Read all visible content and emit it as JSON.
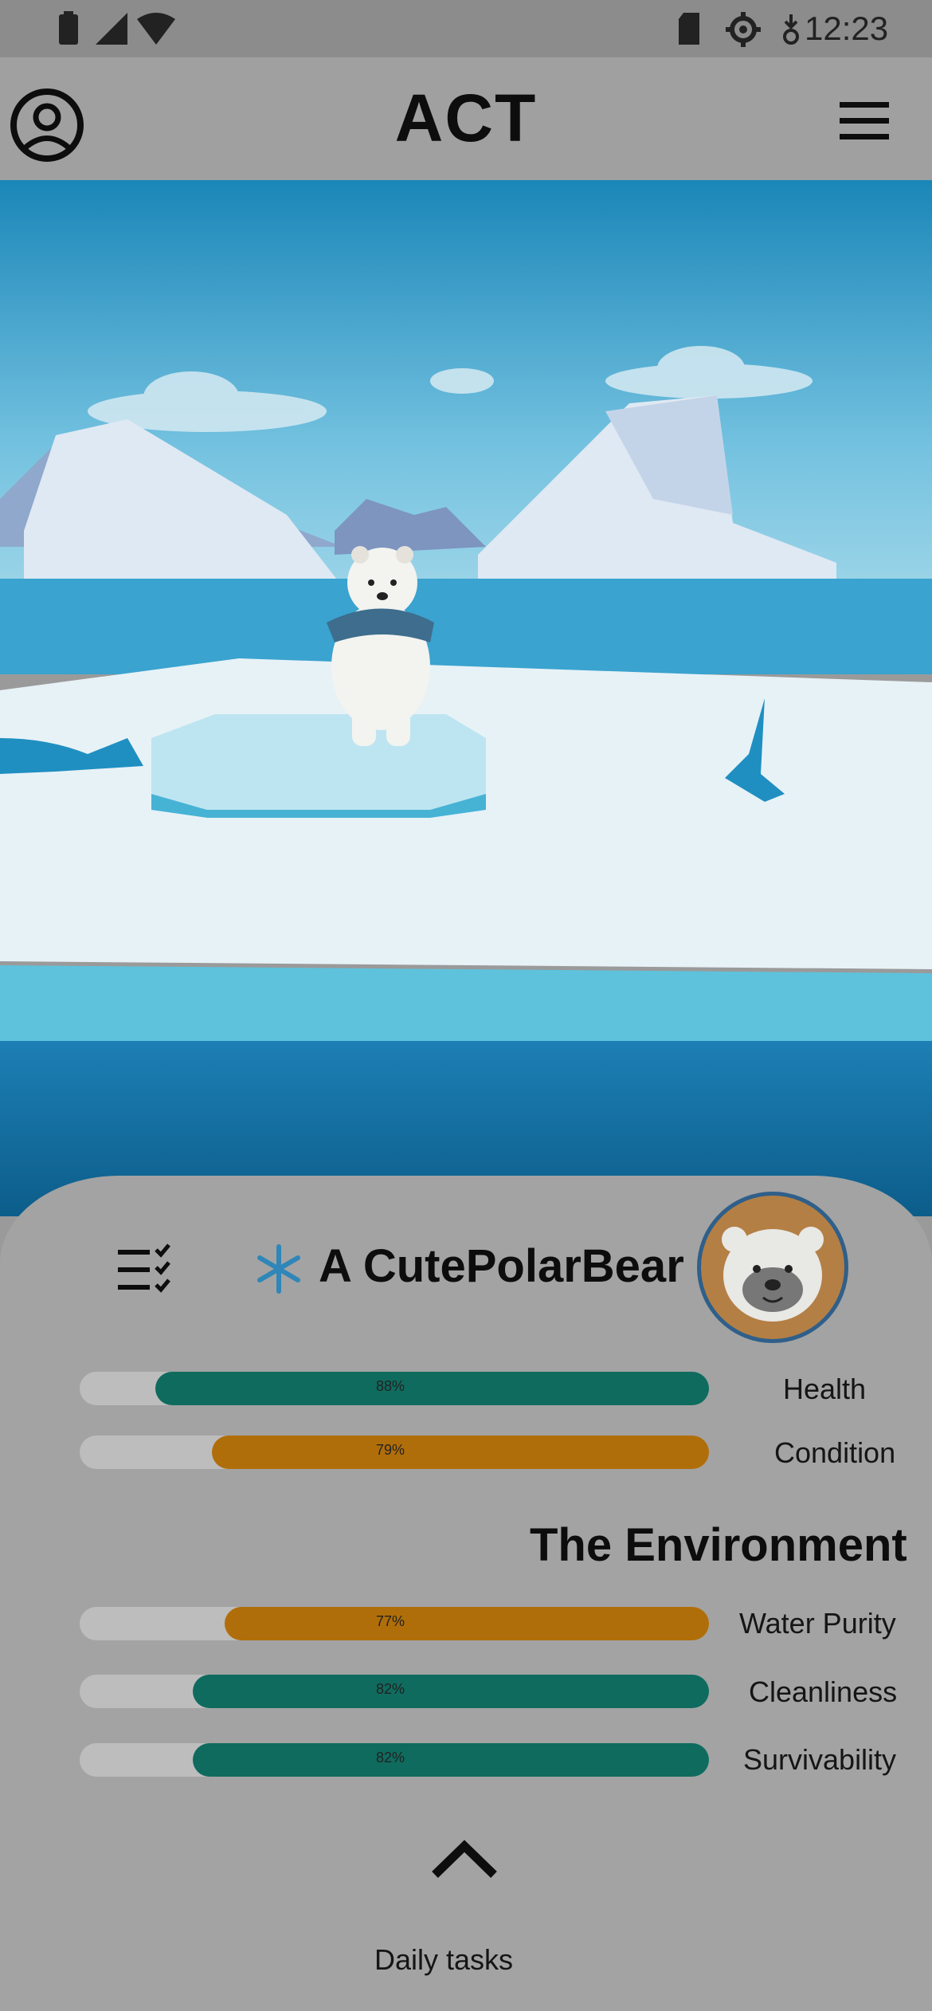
{
  "status_bar": {
    "time": "12:23",
    "icons": [
      "signal-icon",
      "wifi-icon",
      "battery-icon",
      "sd-card-icon",
      "settings-icon",
      "notification-icon"
    ]
  },
  "header": {
    "title": "ACT",
    "left_icon": "account-circle-icon",
    "right_icon": "hamburger-menu-icon"
  },
  "pet": {
    "name": "A CutePolarBear",
    "status_icon": "snowflake-icon",
    "stats": [
      {
        "label": "Health",
        "value": 88,
        "value_text": "88%",
        "color": "#0f6b5e"
      },
      {
        "label": "Condition",
        "value": 79,
        "value_text": "79%",
        "color": "#b06e0a"
      }
    ]
  },
  "environment": {
    "title": "The Environment",
    "stats": [
      {
        "label": "Water Purity",
        "value": 77,
        "value_text": "77%",
        "color": "#b06e0a"
      },
      {
        "label": "Cleanliness",
        "value": 82,
        "value_text": "82%",
        "color": "#0f6b5e"
      },
      {
        "label": "Survivability",
        "value": 82,
        "value_text": "82%",
        "color": "#0f6b5e"
      }
    ]
  },
  "footer": {
    "expand_icon": "chevron-up-icon",
    "label": "Daily tasks"
  }
}
